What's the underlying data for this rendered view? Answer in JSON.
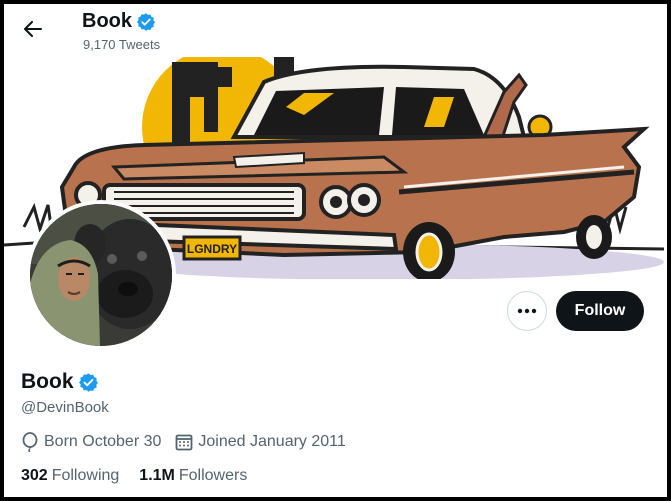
{
  "header": {
    "name": "Book",
    "tweet_count": "9,170 Tweets"
  },
  "banner": {
    "plate_text": "LGNDRY"
  },
  "actions": {
    "follow_label": "Follow"
  },
  "profile": {
    "name": "Book",
    "handle": "@DevinBook",
    "birthday": "Born October 30",
    "joined": "Joined January 2011",
    "following_count": "302",
    "following_label": "Following",
    "followers_count": "1.1M",
    "followers_label": "Followers"
  },
  "icons": {
    "back": "arrow-left-icon",
    "verified": "verified-badge-icon",
    "more": "more-horizontal-icon",
    "birthday": "balloon-icon",
    "calendar": "calendar-icon"
  },
  "colors": {
    "verified_blue": "#1d9bf0",
    "primary_text": "#0f1419",
    "secondary_text": "#536471",
    "follow_button_bg": "#0f1419",
    "border": "#cfd9de"
  }
}
